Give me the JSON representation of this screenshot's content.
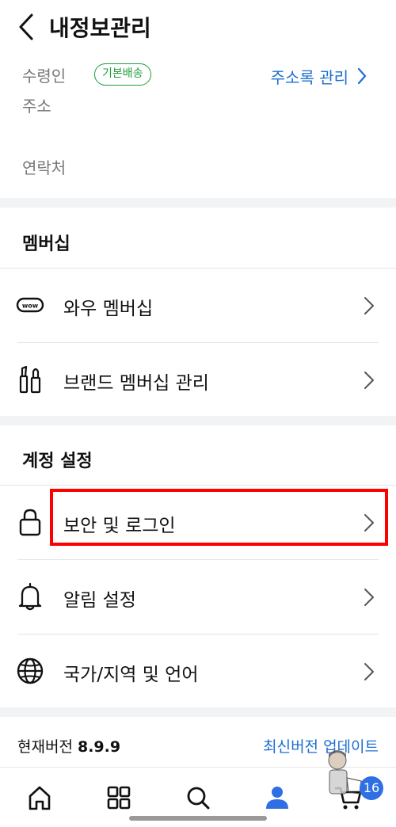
{
  "header": {
    "title": "내정보관리"
  },
  "address": {
    "recipient_label": "수령인",
    "badge": "기본배송",
    "manage_link": "주소록 관리",
    "address_label": "주소",
    "contact_label": "연락처"
  },
  "membership": {
    "title": "멤버십",
    "items": [
      {
        "label": "와우 멤버십",
        "icon": "wow-icon"
      },
      {
        "label": "브랜드 멤버십 관리",
        "icon": "cosmetics-icon"
      }
    ]
  },
  "account": {
    "title": "계정 설정",
    "items": [
      {
        "label": "보안 및 로그인",
        "icon": "lock-icon"
      },
      {
        "label": "알림 설정",
        "icon": "bell-icon"
      },
      {
        "label": "국가/지역 및 언어",
        "icon": "globe-icon"
      }
    ]
  },
  "version": {
    "label": "현재버전",
    "number": "8.9.9",
    "update_link": "최신버전 업데이트"
  },
  "bottom_nav": {
    "items": [
      "home-icon",
      "category-icon",
      "search-icon",
      "my-icon",
      "cart-icon"
    ],
    "cart_badge": "16"
  },
  "colors": {
    "accent_blue": "#1c6fd1",
    "badge_green": "#1f9d3a",
    "highlight_red": "#ff0000",
    "nav_badge": "#2f6fe4"
  }
}
